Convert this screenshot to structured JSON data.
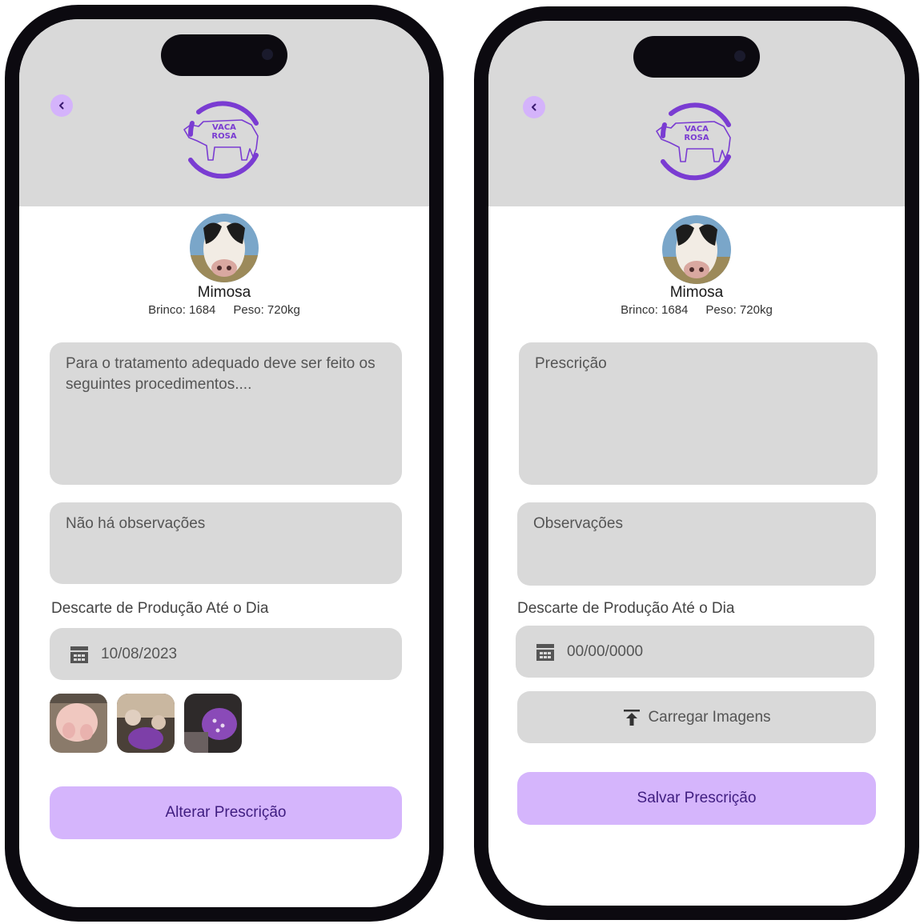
{
  "screens": {
    "left": {
      "cow": {
        "name": "Mimosa",
        "brinco": "Brinco: 1684",
        "peso": "Peso: 720kg"
      },
      "prescription": "Para o tratamento adequado deve ser feito os seguintes procedimentos....",
      "observations": "Não há observações",
      "discard_label": "Descarte de Produção Até o Dia",
      "discard_date": "10/08/2023",
      "action_button": "Alterar Prescrição"
    },
    "right": {
      "cow": {
        "name": "Mimosa",
        "brinco": "Brinco: 1684",
        "peso": "Peso: 720kg"
      },
      "prescription_placeholder": "Prescrição",
      "observations_placeholder": "Observações",
      "discard_label": "Descarte de Produção Até o Dia",
      "discard_date": "00/00/0000",
      "upload_button": "Carregar Imagens",
      "action_button": "Salvar Prescrição"
    }
  },
  "logo": {
    "line1": "VACA",
    "line2": "ROSA"
  },
  "icons": {
    "back": "chevron-left-icon",
    "calendar": "calendar-icon",
    "upload": "upload-icon"
  },
  "colors": {
    "accent": "#d5b5fc",
    "accent_dark": "#7a3cd2",
    "button_text": "#3f1d80",
    "field_bg": "#d9d9d9",
    "frame": "#0c0a10"
  }
}
